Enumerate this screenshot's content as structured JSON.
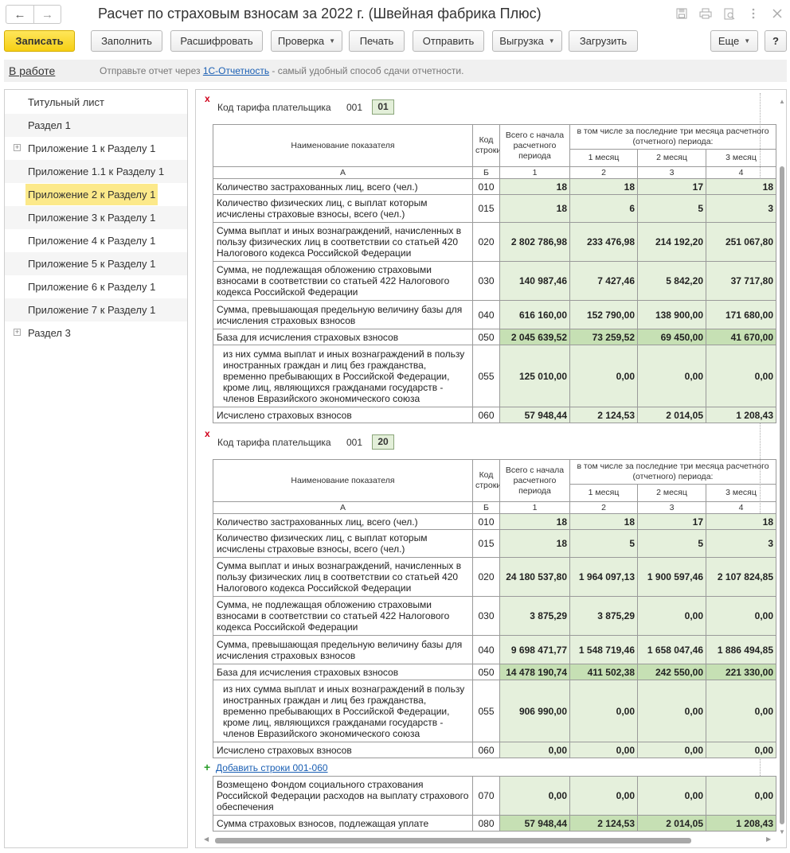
{
  "window": {
    "title": "Расчет по страховым взносам за 2022 г. (Швейная фабрика Плюс)",
    "nav_back": "←",
    "nav_forward": "→",
    "icons": [
      "save-icon",
      "print-icon",
      "preview-icon",
      "more-icon",
      "close-icon"
    ]
  },
  "toolbar": {
    "save": "Записать",
    "fill": "Заполнить",
    "decode": "Расшифровать",
    "check": "Проверка",
    "print": "Печать",
    "send": "Отправить",
    "export": "Выгрузка",
    "load": "Загрузить",
    "more": "Еще",
    "help": "?"
  },
  "status": {
    "state": "В работе",
    "msg_before": "Отправьте отчет через ",
    "msg_link": "1С-Отчетность",
    "msg_after": " - самый удобный способ сдачи отчетности."
  },
  "sidebar": {
    "items": [
      "Титульный лист",
      "Раздел 1",
      "Приложение 1 к Разделу 1",
      "Приложение 1.1 к Разделу 1",
      "Приложение 2 к Разделу 1",
      "Приложение 3 к Разделу 1",
      "Приложение 4 к Разделу 1",
      "Приложение 5 к Разделу 1",
      "Приложение 6 к Разделу 1",
      "Приложение 7 к Разделу 1",
      "Раздел 3"
    ]
  },
  "report": {
    "tarif_label": "Код тарифа плательщика",
    "tarif_code_num": "001",
    "header": {
      "name": "Наименование показателя",
      "code": "Код строки",
      "total": "Всего с начала расчетного периода",
      "last3": "в том числе за последние три месяца расчетного (отчетного) периода:",
      "m1": "1 месяц",
      "m2": "2 месяц",
      "m3": "3 месяц",
      "colA": "А",
      "colB": "Б",
      "col1": "1",
      "col2": "2",
      "col3": "3",
      "col4": "4"
    },
    "row_names": {
      "r010": "Количество застрахованных лиц, всего (чел.)",
      "r015": "Количество физических лиц, с выплат которым исчислены страховые взносы, всего (чел.)",
      "r020": "Сумма выплат и иных вознаграждений, начисленных в пользу физических лиц в соответствии со статьей 420 Налогового кодекса Российской Федерации",
      "r030": "Сумма, не подлежащая обложению страховыми взносами в соответствии со статьей 422 Налогового кодекса Российской Федерации",
      "r040": "Сумма, превышающая предельную величину базы для исчисления страховых взносов",
      "r050": "База для исчисления страховых взносов",
      "r055": "из них сумма выплат и иных вознаграждений в пользу иностранных граждан и лиц без гражданства, временно пребывающих в Российской Федерации, кроме лиц, являющихся гражданами государств - членов Евразийского экономического союза",
      "r060": "Исчислено страховых взносов",
      "r070": "Возмещено Фондом социального страхования Российской Федерации расходов на выплату страхового обеспечения",
      "r080": "Сумма страховых взносов, подлежащая уплате"
    },
    "codes": {
      "r010": "010",
      "r015": "015",
      "r020": "020",
      "r030": "030",
      "r040": "040",
      "r050": "050",
      "r055": "055",
      "r060": "060",
      "r070": "070",
      "r080": "080"
    },
    "block1": {
      "tarif": "01",
      "r010": [
        "18",
        "18",
        "17",
        "18"
      ],
      "r015": [
        "18",
        "6",
        "5",
        "3"
      ],
      "r020": [
        "2 802 786,98",
        "233 476,98",
        "214 192,20",
        "251 067,80"
      ],
      "r030": [
        "140 987,46",
        "7 427,46",
        "5 842,20",
        "37 717,80"
      ],
      "r040": [
        "616 160,00",
        "152 790,00",
        "138 900,00",
        "171 680,00"
      ],
      "r050": [
        "2 045 639,52",
        "73 259,52",
        "69 450,00",
        "41 670,00"
      ],
      "r055": [
        "125 010,00",
        "0,00",
        "0,00",
        "0,00"
      ],
      "r060": [
        "57 948,44",
        "2 124,53",
        "2 014,05",
        "1 208,43"
      ]
    },
    "block2": {
      "tarif": "20",
      "r010": [
        "18",
        "18",
        "17",
        "18"
      ],
      "r015": [
        "18",
        "5",
        "5",
        "3"
      ],
      "r020": [
        "24 180 537,80",
        "1 964 097,13",
        "1 900 597,46",
        "2 107 824,85"
      ],
      "r030": [
        "3 875,29",
        "3 875,29",
        "0,00",
        "0,00"
      ],
      "r040": [
        "9 698 471,77",
        "1 548 719,46",
        "1 658 047,46",
        "1 886 494,85"
      ],
      "r050": [
        "14 478 190,74",
        "411 502,38",
        "242 550,00",
        "221 330,00"
      ],
      "r055": [
        "906 990,00",
        "0,00",
        "0,00",
        "0,00"
      ],
      "r060": [
        "0,00",
        "0,00",
        "0,00",
        "0,00"
      ]
    },
    "add_rows": "Добавить строки 001-060",
    "footer": {
      "r070": [
        "0,00",
        "0,00",
        "0,00",
        "0,00"
      ],
      "r080": [
        "57 948,44",
        "2 124,53",
        "2 014,05",
        "1 208,43"
      ]
    }
  }
}
